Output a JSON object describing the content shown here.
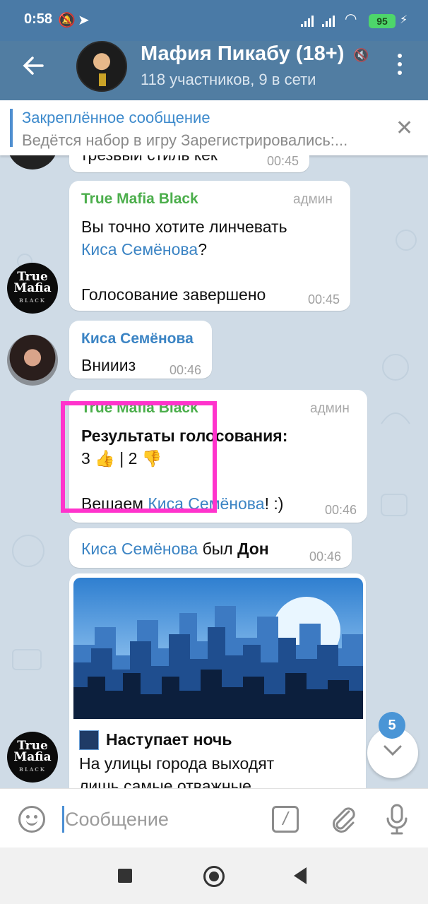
{
  "status_bar": {
    "time": "0:58",
    "battery": "95"
  },
  "header": {
    "title": "Мафия Пикабу (18+)",
    "subtitle": "118 участников, 9 в сети"
  },
  "pinned": {
    "title": "Закреплённое сообщение",
    "text": "Ведётся набор в игру   Зарегистрировались:..."
  },
  "messages": {
    "m0": {
      "text": "трезвый стиль кек",
      "time": "00:45"
    },
    "m1": {
      "sender": "True Mafia Black",
      "role": "админ",
      "line1": "Вы точно хотите линчевать",
      "mention": "Киса Семёнова",
      "q": "?",
      "line3": "Голосование завершено",
      "time": "00:45"
    },
    "m2": {
      "sender": "Киса Семёнова",
      "text": "Вниииз",
      "time": "00:46"
    },
    "m3": {
      "sender": "True Mafia Black",
      "role": "админ",
      "title": "Результаты голосования:",
      "votes": "3 👍  |  2 👎",
      "prefix": "Вешаем ",
      "mention": "Киса Семёнова",
      "suffix": "! :)",
      "time": "00:46"
    },
    "m4": {
      "mention": "Киса Семёнова",
      "middle": " был ",
      "role": "Дон",
      "time": "00:46"
    },
    "m5": {
      "title": "Наступает ночь",
      "text1": "На улицы города выходят",
      "text2": "лишь самые отважные..."
    }
  },
  "avatars": {
    "mafia_line1": "True",
    "mafia_line2": "Mafia",
    "mafia_line3": "BLACK"
  },
  "scroll_badge": "5",
  "input": {
    "placeholder": "Сообщение"
  },
  "colors": {
    "header": "#517da2",
    "admin_sender": "#4cae4c",
    "user_sender": "#3b84c4",
    "highlight": "#ff33cc"
  }
}
